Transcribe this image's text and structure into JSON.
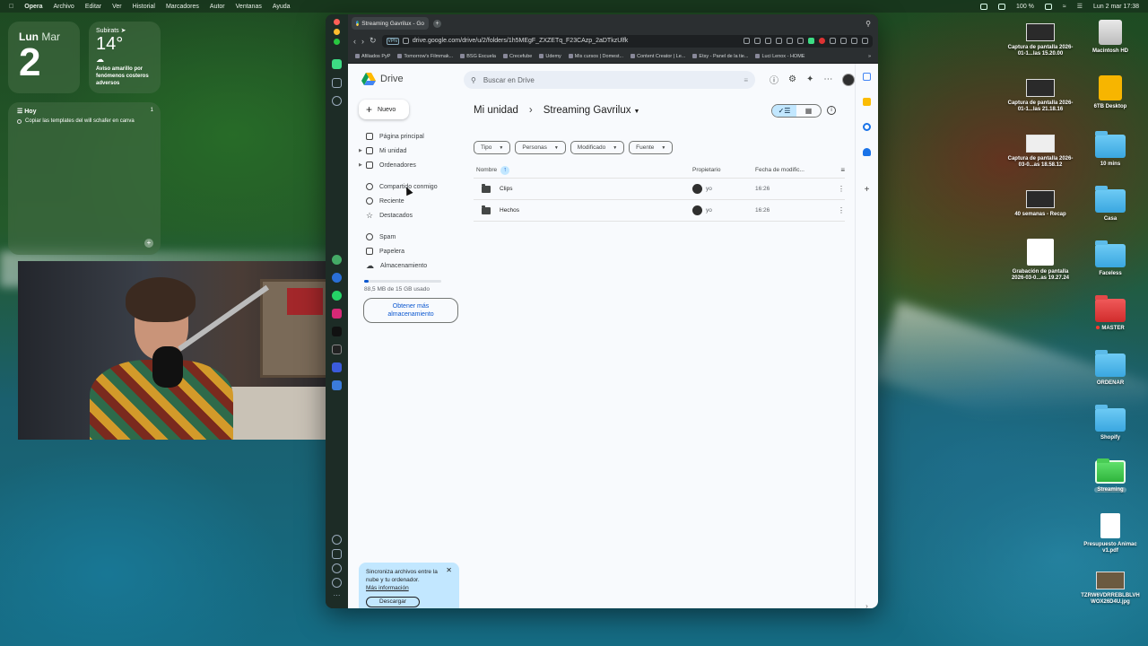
{
  "menubar": {
    "items": [
      "Opera",
      "Archivo",
      "Editar",
      "Ver",
      "Historial",
      "Marcadores",
      "Autor",
      "Ventanas",
      "Ayuda"
    ],
    "battery": "100 %",
    "datetime": "Lun 2 mar 17:38"
  },
  "widgets": {
    "calendar": {
      "weekday": "Lun",
      "month": "Mar",
      "day": "2"
    },
    "weather": {
      "city": "Subirats",
      "temp": "14°",
      "alert": "Aviso amarillo por fenómenos costeros adversos"
    },
    "reminders": {
      "heading": "Hoy",
      "count": "1",
      "items": [
        "Copiar las templates del will schafer en canva"
      ]
    }
  },
  "browser": {
    "tab_title": "Streaming Gavrilux - Go",
    "url": "drive.google.com/drive/u/2/folders/1h5MEgF_ZXZETq_F23CAzp_2aDTkzUlfk",
    "vpn": "VPN",
    "bookmarks": [
      "Afiliados PyP",
      "Tomorrow's Filmmak...",
      "BSG Escuela",
      "Crecefube",
      "Udemy",
      "Mis cursos | Domest...",
      "Content Creator | Le...",
      "Etsy - Panel de la tie...",
      "Luci Lenox - HOME"
    ]
  },
  "drive": {
    "logo_text": "Drive",
    "search_placeholder": "Buscar en Drive",
    "new_button": "Nuevo",
    "nav": [
      {
        "label": "Página principal",
        "icon": "home-icon"
      },
      {
        "label": "Mi unidad",
        "icon": "drive-icon"
      },
      {
        "label": "Ordenadores",
        "icon": "computer-icon"
      },
      {
        "label": "Compartido conmigo",
        "icon": "people-icon"
      },
      {
        "label": "Reciente",
        "icon": "clock-icon"
      },
      {
        "label": "Destacados",
        "icon": "star-icon"
      },
      {
        "label": "Spam",
        "icon": "spam-icon"
      },
      {
        "label": "Papelera",
        "icon": "trash-icon"
      },
      {
        "label": "Almacenamiento",
        "icon": "cloud-icon"
      }
    ],
    "storage": {
      "used_text": "88,5 MB de 15 GB usado",
      "fraction": 0.006,
      "button": "Obtener más almacenamiento"
    },
    "breadcrumb": {
      "root": "Mi unidad",
      "current": "Streaming Gavrilux"
    },
    "filters": [
      "Tipo",
      "Personas",
      "Modificado",
      "Fuente"
    ],
    "table": {
      "headers": {
        "name": "Nombre",
        "owner": "Propietario",
        "modified": "Fecha de modific..."
      },
      "rows": [
        {
          "name": "Clips",
          "owner": "yo",
          "modified": "16:26"
        },
        {
          "name": "Hechos",
          "owner": "yo",
          "modified": "16:26"
        }
      ]
    },
    "sync_card": {
      "text": "Sincroniza archivos entre la nube y tu ordenador.",
      "link": "Más información",
      "button": "Descargar"
    }
  },
  "desktop_icons": [
    {
      "label": "Captura de pantalla 2026-01-1...las 15.20.00",
      "kind": "screenshot"
    },
    {
      "label": "Macintosh HD",
      "kind": "disk"
    },
    {
      "label": "Captura de pantalla 2026-01-1...las 21.18.16",
      "kind": "screenshot"
    },
    {
      "label": "6TB Desktop",
      "kind": "external-disk"
    },
    {
      "label": "Captura de pantalla 2026-03-0...as 18.58.12",
      "kind": "screenshot"
    },
    {
      "label": "10 mins",
      "kind": "folder"
    },
    {
      "label": "40 semanas - Recap",
      "kind": "screenshot"
    },
    {
      "label": "Casa",
      "kind": "folder"
    },
    {
      "label": "Grabación de pantalla 2026-03-0...as 19.27.24",
      "kind": "video"
    },
    {
      "label": "Faceless",
      "kind": "folder"
    },
    {
      "label": "MASTER",
      "kind": "folder-red"
    },
    {
      "label": "ORDENAR",
      "kind": "folder"
    },
    {
      "label": "Shopify",
      "kind": "folder"
    },
    {
      "label": "Streaming",
      "kind": "folder-green"
    },
    {
      "label": "Presupuesto Animac v1.pdf",
      "kind": "pdf"
    },
    {
      "label": "TZRW6VDRREBLBLVH WOX26D4U.jpg",
      "kind": "image"
    }
  ]
}
